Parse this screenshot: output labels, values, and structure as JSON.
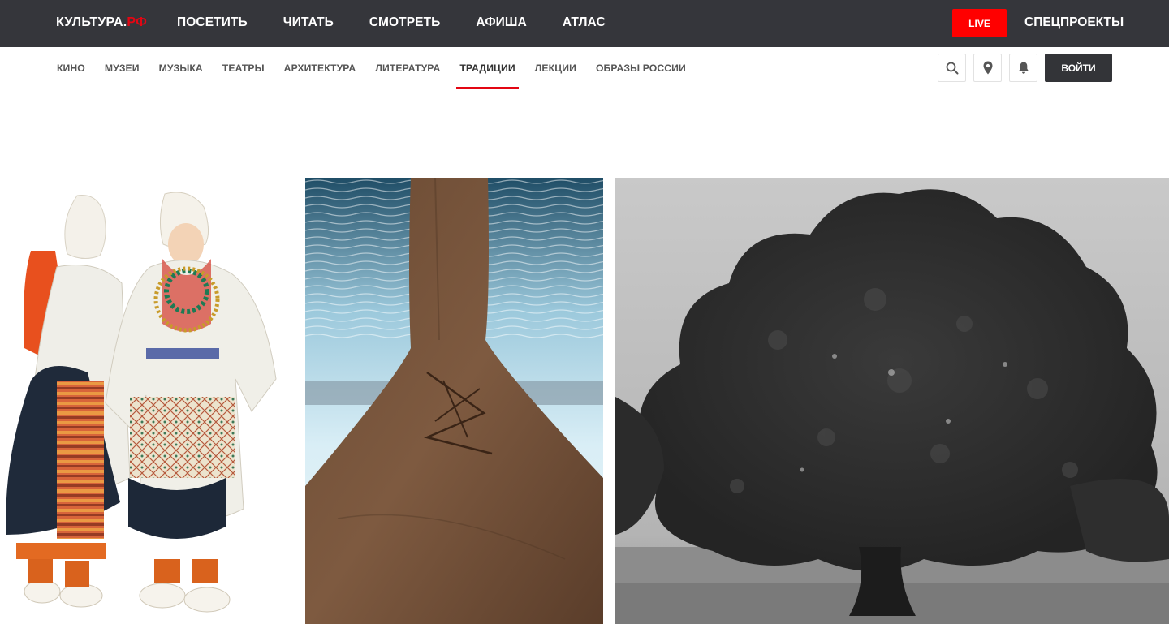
{
  "header": {
    "logo_main": "КУЛЬТУРА.",
    "logo_accent": "РФ",
    "nav": [
      {
        "label": "ПОСЕТИТЬ"
      },
      {
        "label": "ЧИТАТЬ"
      },
      {
        "label": "СМОТРЕТЬ"
      },
      {
        "label": "АФИША"
      },
      {
        "label": "АТЛАС"
      }
    ],
    "live_label": "LIVE",
    "special_label": "СПЕЦПРОЕКТЫ"
  },
  "subnav": {
    "items": [
      {
        "label": "КИНО"
      },
      {
        "label": "МУЗЕИ"
      },
      {
        "label": "МУЗЫКА"
      },
      {
        "label": "ТЕАТРЫ"
      },
      {
        "label": "АРХИТЕКТУРА"
      },
      {
        "label": "ЛИТЕРАТУРА"
      },
      {
        "label": "ТРАДИЦИИ",
        "active": true
      },
      {
        "label": "ЛЕКЦИИ"
      },
      {
        "label": "ОБРАЗЫ РОССИИ"
      }
    ],
    "login_label": "ВОЙТИ"
  },
  "icons": {
    "search": "search-icon",
    "location": "location-pin-icon",
    "notifications": "bell-icon"
  },
  "colors": {
    "header_bg": "#35363b",
    "accent_red": "#e30613",
    "live_red": "#ff0000",
    "login_bg": "#333438"
  }
}
